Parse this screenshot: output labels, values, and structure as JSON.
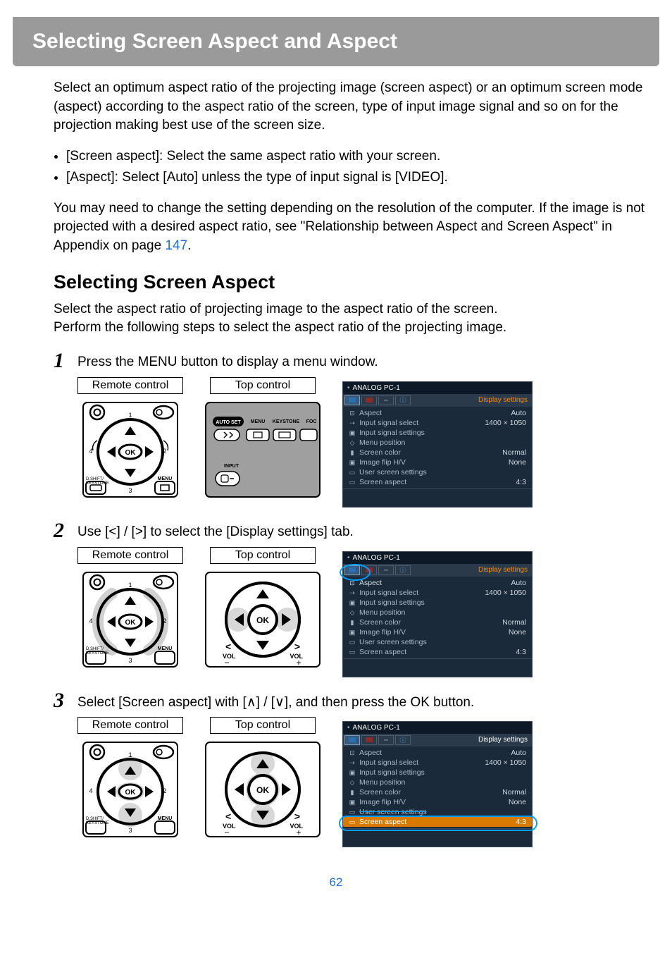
{
  "title": "Selecting Screen Aspect and Aspect",
  "intro": "Select an optimum aspect ratio of the projecting image (screen aspect) or an optimum screen mode (aspect) according to the aspect ratio of the screen, type of input image signal and so on for the projection making best use of the screen size.",
  "bullet1_lead": "[Screen aspect]",
  "bullet1_rest": ": Select the same aspect ratio with your screen.",
  "bullet2_lead": "[Aspect]",
  "bullet2_rest": ": Select [Auto] unless the type of input signal is [VIDEO].",
  "para2a": "You may need to change the setting depending on the resolution of the computer. If the image is not projected with a desired aspect ratio, see \"Relationship between Aspect and Screen Aspect\" in Appendix on page ",
  "para2_link": "147",
  "para2b": ".",
  "section_heading": "Selecting Screen Aspect",
  "section_intro": "Select the aspect ratio of projecting image to the aspect ratio of the screen.\nPerform the following steps to select the aspect ratio of the projecting image.",
  "steps": {
    "s1": "Press the MENU button to display a menu window.",
    "s2": "Use [<] / [>] to select the [Display settings] tab.",
    "s3": "Select [Screen aspect] with [∧] / [∨], and then press the OK button."
  },
  "labels": {
    "remote": "Remote control",
    "top": "Top control",
    "display_settings": "Display settings",
    "analog": "ANALOG PC-1",
    "auto_set": "AUTO SET",
    "menu_btn": "MENU",
    "keystone_btn": "KEYSTONE",
    "foc_btn": "FOC",
    "input_btn": "INPUT",
    "ok": "OK",
    "vol_minus": "VOL\n−",
    "vol_plus": "VOL\n+",
    "dshift": "D.SHIFT/\nKEYSTONE",
    "menu_small": "MENU"
  },
  "menu": {
    "items": [
      {
        "icon": "⊡",
        "label": "Aspect",
        "value": "Auto"
      },
      {
        "icon": "⇢",
        "label": "Input signal select",
        "value": "1400 × 1050"
      },
      {
        "icon": "▣",
        "label": "Input signal settings",
        "value": ""
      },
      {
        "icon": "◇",
        "label": "Menu position",
        "value": ""
      },
      {
        "icon": "▮",
        "label": "Screen color",
        "value": "Normal"
      },
      {
        "icon": "▣",
        "label": "Image flip H/V",
        "value": "None"
      },
      {
        "icon": "▭",
        "label": "User screen settings",
        "value": ""
      },
      {
        "icon": "▭",
        "label": "Screen aspect",
        "value": "4:3"
      }
    ]
  },
  "page_number": "62"
}
